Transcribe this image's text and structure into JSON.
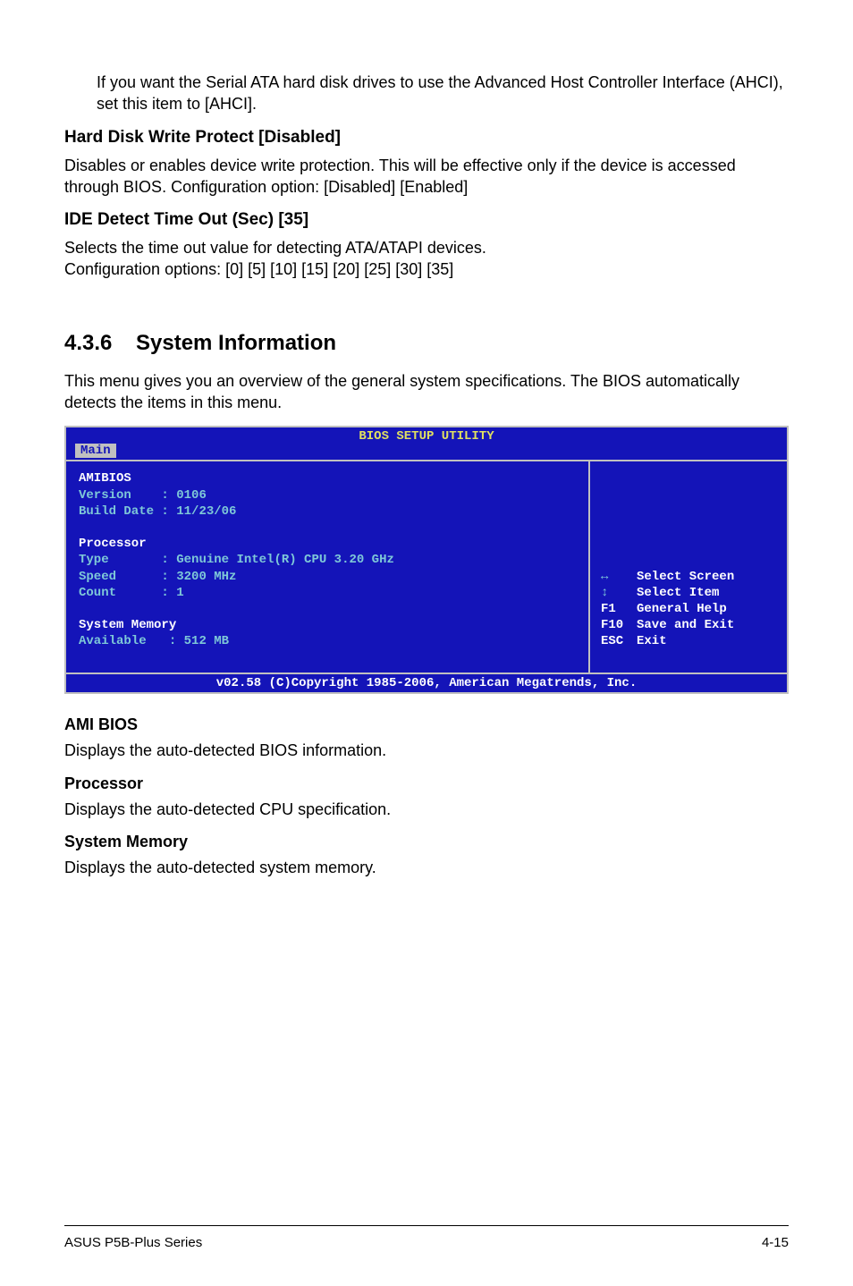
{
  "intro": {
    "para": "If you want the Serial ATA hard disk drives to use the Advanced Host Controller Interface (AHCI), set this item to [AHCI]."
  },
  "sections": [
    {
      "heading": "Hard Disk Write Protect [Disabled]",
      "para": "Disables or enables device write protection. This will be effective only if the device is accessed through BIOS. Configuration option: [Disabled] [Enabled]"
    },
    {
      "heading": "IDE Detect Time Out (Sec) [35]",
      "para": "Selects the time out value for detecting ATA/ATAPI devices.\nConfiguration options: [0] [5] [10] [15] [20] [25] [30] [35]"
    }
  ],
  "sysinfo": {
    "num": "4.3.6",
    "title": "System Information",
    "intro": "This menu gives you an overview of the general system specifications. The BIOS automatically detects the items in this menu."
  },
  "bios": {
    "title": "BIOS SETUP UTILITY",
    "tab": "Main",
    "amibios": {
      "label": "AMIBIOS",
      "version_label": "Version",
      "version_value": "0106",
      "builddate_label": "Build Date",
      "builddate_value": "11/23/06"
    },
    "processor": {
      "label": "Processor",
      "type_label": "Type",
      "type_value": "Genuine Intel(R) CPU 3.20 GHz",
      "speed_label": "Speed",
      "speed_value": "3200 MHz",
      "count_label": "Count",
      "count_value": "1"
    },
    "memory": {
      "label": "System Memory",
      "available_label": "Available",
      "available_value": "512 MB"
    },
    "help": {
      "select_screen": "Select Screen",
      "select_item": "Select Item",
      "f1": "General Help",
      "f10": "Save and Exit",
      "esc": "Exit",
      "f1_key": "F1",
      "f10_key": "F10",
      "esc_key": "ESC"
    },
    "footer": "v02.58 (C)Copyright 1985-2006, American Megatrends, Inc."
  },
  "after": [
    {
      "heading": "AMI BIOS",
      "para": "Displays the auto-detected BIOS information."
    },
    {
      "heading": "Processor",
      "para": "Displays the auto-detected CPU specification."
    },
    {
      "heading": "System Memory",
      "para": "Displays the auto-detected system memory."
    }
  ],
  "footer": {
    "left": "ASUS P5B-Plus Series",
    "right": "4-15"
  }
}
